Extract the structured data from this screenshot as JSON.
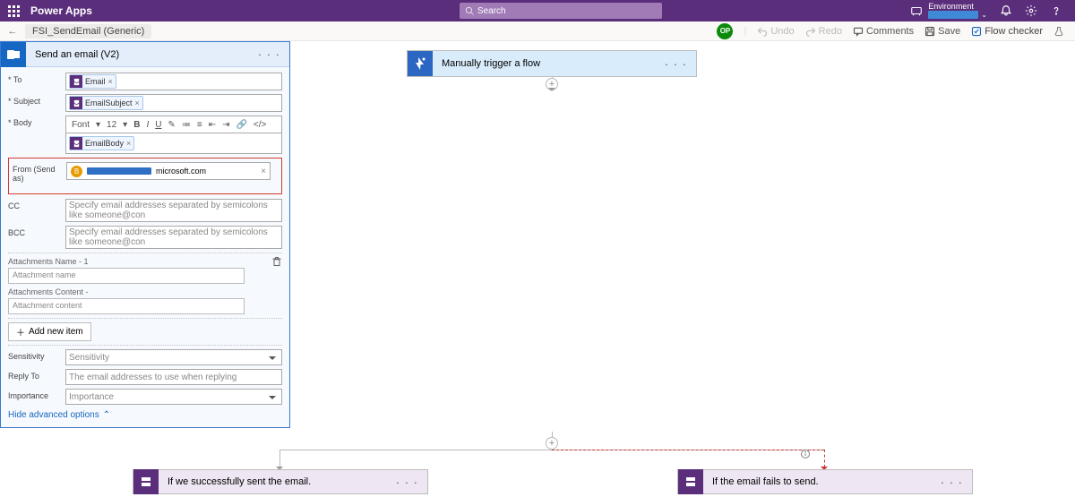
{
  "header": {
    "app_name": "Power Apps",
    "search_placeholder": "Search",
    "environment_label": "Environment"
  },
  "subheader": {
    "flow_name": "FSI_SendEmail (Generic)",
    "user_initials": "OP",
    "undo": "Undo",
    "redo": "Redo",
    "comments": "Comments",
    "save": "Save",
    "flow_checker": "Flow checker"
  },
  "trigger": {
    "title": "Manually trigger a flow"
  },
  "email_action": {
    "title": "Send an email (V2)",
    "labels": {
      "to": "To",
      "subject": "Subject",
      "body": "Body",
      "from": "From (Send as)",
      "cc": "CC",
      "bcc": "BCC",
      "att_name": "Attachments Name - 1",
      "att_content": "Attachments Content -",
      "sensitivity": "Sensitivity",
      "reply_to": "Reply To",
      "importance": "Importance"
    },
    "tokens": {
      "email": "Email",
      "subject": "EmailSubject",
      "body": "EmailBody"
    },
    "from_domain": "microsoft.com",
    "rte": {
      "font": "Font",
      "size": "12"
    },
    "placeholders": {
      "cc": "Specify email addresses separated by semicolons like someone@con",
      "bcc": "Specify email addresses separated by semicolons like someone@con",
      "att_name": "Attachment name",
      "att_content": "Attachment content",
      "sensitivity": "Sensitivity",
      "reply_to": "The email addresses to use when replying",
      "importance": "Importance"
    },
    "add_item": "Add new item",
    "hide_advanced": "Hide advanced options"
  },
  "branches": {
    "success": "If we successfully sent the email.",
    "fail": "If the email fails to send."
  }
}
